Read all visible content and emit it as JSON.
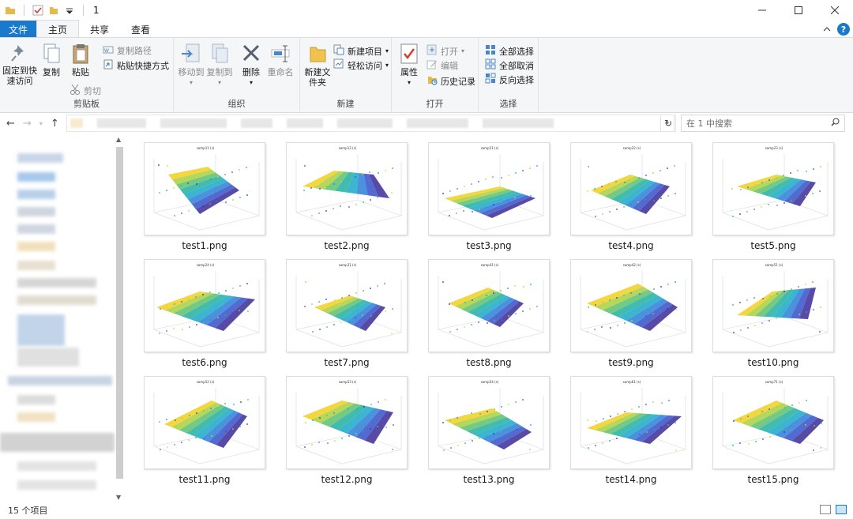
{
  "window": {
    "title": "1"
  },
  "tabs": {
    "file": "文件",
    "home": "主页",
    "share": "共享",
    "view": "查看"
  },
  "ribbon": {
    "clipboard": {
      "label": "剪贴板",
      "pin": "固定到快速访问",
      "copy": "复制",
      "paste": "粘贴",
      "copy_path": "复制路径",
      "paste_shortcut": "粘贴快捷方式",
      "cut": "剪切"
    },
    "organize": {
      "label": "组织",
      "move_to": "移动到",
      "copy_to": "复制到",
      "delete": "删除",
      "rename": "重命名"
    },
    "new": {
      "label": "新建",
      "new_folder": "新建文件夹",
      "new_item": "新建项目",
      "easy_access": "轻松访问"
    },
    "open": {
      "label": "打开",
      "properties": "属性",
      "open": "打开",
      "edit": "编辑",
      "history": "历史记录"
    },
    "select": {
      "label": "选择",
      "select_all": "全部选择",
      "select_none": "全部取消",
      "invert": "反向选择"
    }
  },
  "search": {
    "placeholder": "在 1 中搜索"
  },
  "files": [
    {
      "name": "test1.png",
      "plot_title": "samp11 (s)"
    },
    {
      "name": "test2.png",
      "plot_title": "samp12 (s)"
    },
    {
      "name": "test3.png",
      "plot_title": "samp21 (s)"
    },
    {
      "name": "test4.png",
      "plot_title": "samp22 (s)"
    },
    {
      "name": "test5.png",
      "plot_title": "samp23 (s)"
    },
    {
      "name": "test6.png",
      "plot_title": "samp24 (s)"
    },
    {
      "name": "test7.png",
      "plot_title": "samp31 (s)"
    },
    {
      "name": "test8.png",
      "plot_title": "samp41 (s)"
    },
    {
      "name": "test9.png",
      "plot_title": "samp42 (s)"
    },
    {
      "name": "test10.png",
      "plot_title": "samp51 (s)"
    },
    {
      "name": "test11.png",
      "plot_title": "samp52 (s)"
    },
    {
      "name": "test12.png",
      "plot_title": "samp53 (s)"
    },
    {
      "name": "test13.png",
      "plot_title": "samp54 (s)"
    },
    {
      "name": "test14.png",
      "plot_title": "samp61 (s)"
    },
    {
      "name": "test15.png",
      "plot_title": "samp71 (s)"
    }
  ],
  "status": {
    "count": "15 个项目"
  },
  "colors": {
    "accent": "#1979ca",
    "ribbon_bg": "#f5f6f7",
    "plot_low": "#3b2a98",
    "plot_mid": "#20b0a0",
    "plot_high": "#f0d020"
  }
}
